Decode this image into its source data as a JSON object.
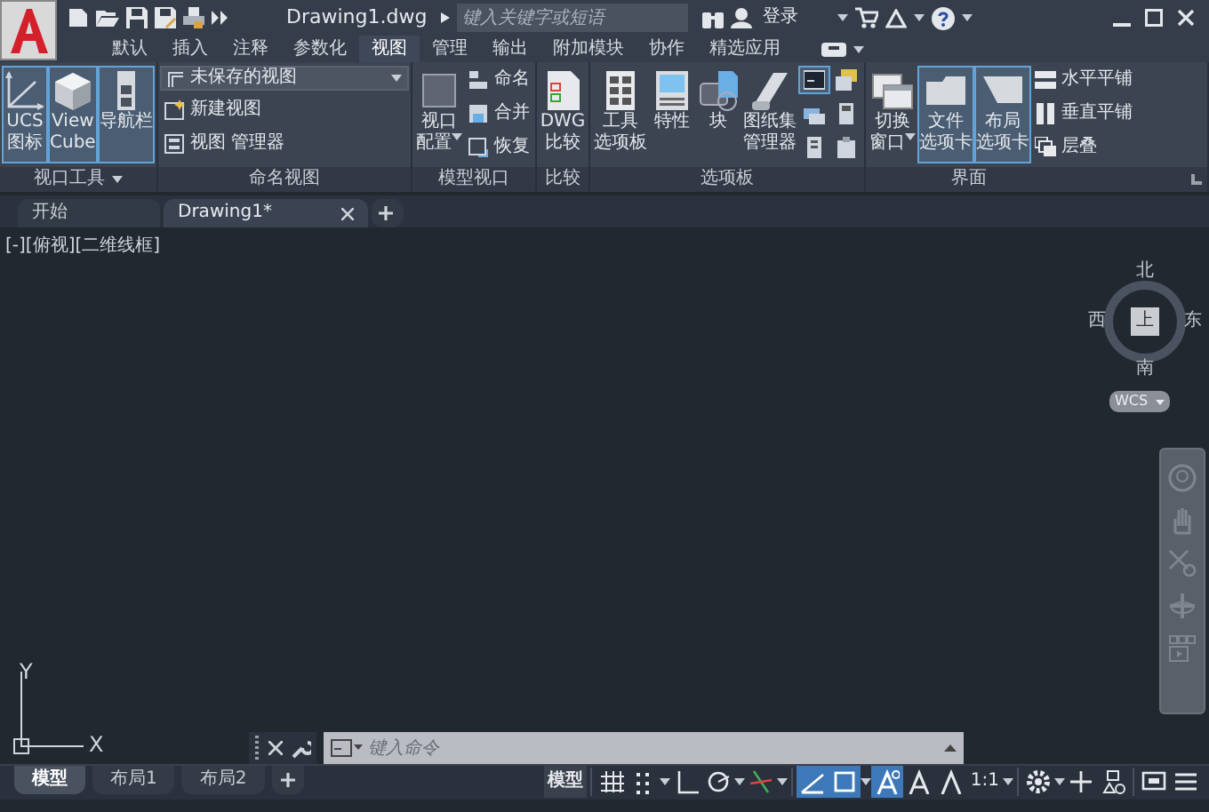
{
  "title_bar": {
    "file_title": "Drawing1.dwg",
    "search": {
      "placeholder": "键入关键字或短语"
    },
    "login": "登录"
  },
  "ribbon_tabs": [
    {
      "label": "默认",
      "selected": false
    },
    {
      "label": "插入",
      "selected": false
    },
    {
      "label": "注释",
      "selected": false
    },
    {
      "label": "参数化",
      "selected": false
    },
    {
      "label": "视图",
      "selected": true
    },
    {
      "label": "管理",
      "selected": false
    },
    {
      "label": "输出",
      "selected": false
    },
    {
      "label": "附加模块",
      "selected": false
    },
    {
      "label": "协作",
      "selected": false
    },
    {
      "label": "精选应用",
      "selected": false
    }
  ],
  "ribbon_panels": [
    {
      "title": "视口工具",
      "has_menu": true,
      "items": [
        {
          "kind": "large",
          "lines": [
            "UCS",
            "图标"
          ],
          "on": true
        },
        {
          "kind": "large",
          "lines": [
            "View",
            "Cube"
          ],
          "on": true
        },
        {
          "kind": "large",
          "lines": [
            "导航栏"
          ],
          "on": true
        }
      ]
    },
    {
      "title": "命名视图",
      "has_menu": false,
      "items": [
        {
          "kind": "stack",
          "items": [
            {
              "kind": "dropdown",
              "label": "未保存的视图"
            },
            {
              "kind": "small",
              "label": "新建视图"
            },
            {
              "kind": "small",
              "label": "视图 管理器"
            }
          ]
        }
      ]
    },
    {
      "title": "模型视口",
      "has_menu": false,
      "items": [
        {
          "kind": "large",
          "lines": [
            "视口",
            "配置"
          ],
          "on": false,
          "has_menu": true
        },
        {
          "kind": "stack",
          "items": [
            {
              "kind": "small",
              "label": "命名"
            },
            {
              "kind": "small",
              "label": "合并"
            },
            {
              "kind": "small",
              "label": "恢复"
            }
          ]
        }
      ]
    },
    {
      "title": "比较",
      "has_menu": false,
      "items": [
        {
          "kind": "large",
          "lines": [
            "DWG",
            "比较"
          ],
          "on": false
        }
      ]
    },
    {
      "title": "选项板",
      "has_menu": false,
      "items": [
        {
          "kind": "large",
          "lines": [
            "工具",
            "选项板"
          ],
          "on": false
        },
        {
          "kind": "large",
          "lines": [
            "特性"
          ],
          "on": false
        },
        {
          "kind": "large",
          "lines": [
            "块"
          ],
          "on": false
        },
        {
          "kind": "large",
          "lines": [
            "图纸集",
            "管理器"
          ],
          "on": false
        },
        {
          "kind": "stack",
          "items": [
            {
              "kind": "icon",
              "on": true
            },
            {
              "kind": "icon",
              "on": false
            },
            {
              "kind": "icon",
              "on": false
            }
          ]
        },
        {
          "kind": "stack",
          "items": [
            {
              "kind": "icon",
              "on": false
            },
            {
              "kind": "icon",
              "on": false
            },
            {
              "kind": "icon",
              "on": false
            }
          ]
        }
      ]
    },
    {
      "title": "界面",
      "has_menu": false,
      "items": [
        {
          "kind": "large",
          "lines": [
            "切换",
            "窗口"
          ],
          "on": false,
          "has_menu": true
        },
        {
          "kind": "large",
          "lines": [
            "文件",
            "选项卡"
          ],
          "on": true
        },
        {
          "kind": "large",
          "lines": [
            "布局",
            "选项卡"
          ],
          "on": true
        },
        {
          "kind": "stack",
          "items": [
            {
              "kind": "small",
              "label": "水平平铺"
            },
            {
              "kind": "small",
              "label": "垂直平铺"
            },
            {
              "kind": "small",
              "label": "层叠"
            }
          ]
        }
      ]
    }
  ],
  "document_tabs": [
    {
      "label": "开始",
      "selected": false,
      "closable": false
    },
    {
      "label": "Drawing1*",
      "selected": true,
      "closable": true
    }
  ],
  "viewport": {
    "controls": "[-][俯视][二维线框]",
    "viewcube": {
      "north": "北",
      "west": "西",
      "east": "东",
      "south": "南",
      "face": "上",
      "wcs": "WCS"
    },
    "ucs": {
      "x_label": "X",
      "y_label": "Y"
    }
  },
  "command_line": {
    "placeholder": "键入命令"
  },
  "layout_tabs": [
    {
      "label": "模型",
      "selected": true
    },
    {
      "label": "布局1",
      "selected": false
    },
    {
      "label": "布局2",
      "selected": false
    }
  ],
  "status_bar": [
    {
      "kind": "label",
      "label": "模型"
    },
    {
      "kind": "toggle",
      "on": false,
      "has_menu": false
    },
    {
      "kind": "toggle",
      "on": false,
      "has_menu": true
    },
    {
      "kind": "toggle",
      "on": false,
      "has_menu": false
    },
    {
      "kind": "toggle",
      "on": false,
      "has_menu": true
    },
    {
      "kind": "toggle",
      "on": false,
      "has_menu": true
    },
    {
      "kind": "toggle",
      "on": true,
      "has_menu": false
    },
    {
      "kind": "toggle",
      "on": true,
      "has_menu": true
    },
    {
      "kind": "toggle",
      "on": true,
      "has_menu": false
    },
    {
      "kind": "toggle",
      "on": false,
      "has_menu": false
    },
    {
      "kind": "toggle",
      "on": false,
      "has_menu": false
    },
    {
      "kind": "label",
      "label": "1:1",
      "has_menu": true
    },
    {
      "kind": "tool",
      "has_menu": true
    },
    {
      "kind": "tool",
      "has_menu": false
    },
    {
      "kind": "tool",
      "has_menu": false
    },
    {
      "kind": "tool",
      "has_menu": false
    },
    {
      "kind": "tool",
      "has_menu": false
    }
  ]
}
